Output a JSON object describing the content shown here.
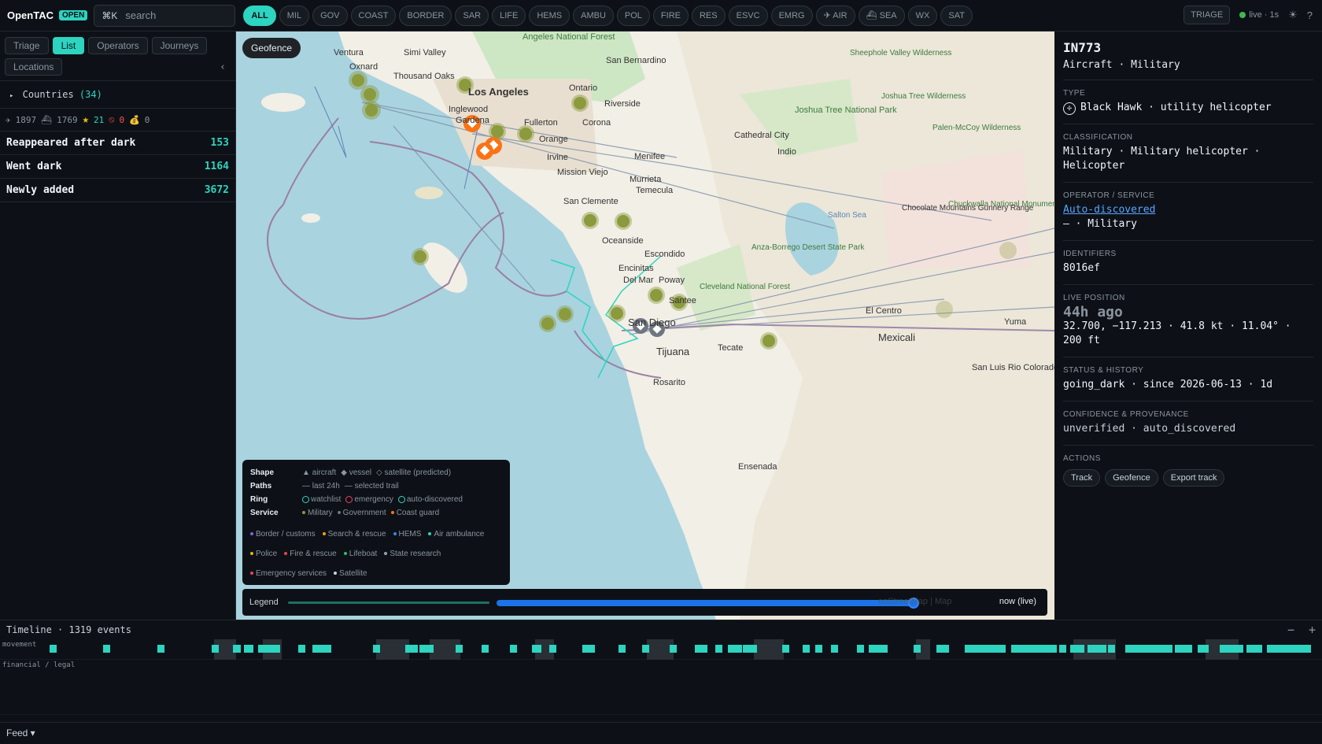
{
  "app": {
    "name": "OpenTAC",
    "badge": "OPEN"
  },
  "search": {
    "shortcut": "⌘K",
    "placeholder": "search"
  },
  "filters": [
    "ALL",
    "MIL",
    "GOV",
    "COAST",
    "BORDER",
    "SAR",
    "LIFE",
    "HEMS",
    "AMBU",
    "POL",
    "FIRE",
    "RES",
    "ESVC",
    "EMRG",
    "✈ AIR",
    "⛴ SEA",
    "WX",
    "SAT"
  ],
  "active_filter": "ALL",
  "topright": {
    "triage": "TRIAGE",
    "live": "live · 1s",
    "theme_icon": "☀",
    "help": "?"
  },
  "sidebar": {
    "tabs": [
      "Triage",
      "List",
      "Operators",
      "Journeys",
      "Locations"
    ],
    "active_tab": "List",
    "collapse": "‹",
    "countries_label": "Countries",
    "countries_count": "(34)",
    "stats": {
      "air": "1897",
      "sea": "1769",
      "star": "21",
      "blocked": "0",
      "money": "0"
    },
    "rows": [
      {
        "label": "Reappeared after dark",
        "count": "153"
      },
      {
        "label": "Went dark",
        "count": "1164"
      },
      {
        "label": "Newly added",
        "count": "3672"
      }
    ]
  },
  "map": {
    "geofence": "Geofence",
    "place_labels": [
      "Ventura",
      "Oxnard",
      "Simi Valley",
      "Thousand Oaks",
      "Angeles National Forest",
      "Los Angeles",
      "Ontario",
      "San Bernardino",
      "Inglewood",
      "Gardena",
      "Fullerton",
      "Corona",
      "Riverside",
      "Orange",
      "Irvine",
      "Mission Viejo",
      "Menifee",
      "Murrieta",
      "Temecula",
      "San Clemente",
      "Oceanside",
      "Escondido",
      "Encinitas",
      "Del Mar",
      "Poway",
      "San Diego",
      "Tijuana",
      "Rosarito",
      "Tecate",
      "Ensenada",
      "Mexicali",
      "El Centro",
      "Yuma",
      "San Luis Rio Colorado",
      "Joshua Tree National Park",
      "Cathedral City",
      "Indio",
      "Salton Sea",
      "Chocolate Mountains Gunnery Range",
      "Chuckwalla National Monument",
      "Anza-Borrego Desert State Park",
      "Cleveland National Forest",
      "Sheephole Valley Wilderness",
      "Joshua Tree Wilderness",
      "Palen-McCoy Wilderness",
      "Santee"
    ],
    "legend": {
      "shape_label": "Shape",
      "shape": [
        "▲ aircraft",
        "◆ vessel",
        "◇ satellite (predicted)"
      ],
      "paths_label": "Paths",
      "paths": [
        "— last 24h",
        "— selected trail"
      ],
      "ring_label": "Ring",
      "ring": [
        "watchlist",
        "emergency",
        "auto-discovered"
      ],
      "service_label": "Service",
      "services": [
        {
          "name": "Military",
          "color": "#8b9a3c"
        },
        {
          "name": "Government",
          "color": "#6e7681"
        },
        {
          "name": "Coast guard",
          "color": "#f97316"
        },
        {
          "name": "Border / customs",
          "color": "#8b5cf6"
        },
        {
          "name": "Search & rescue",
          "color": "#f59e0b"
        },
        {
          "name": "HEMS",
          "color": "#3b82f6"
        },
        {
          "name": "Air ambulance",
          "color": "#2dd4bf"
        },
        {
          "name": "Police",
          "color": "#eab308"
        },
        {
          "name": "Fire & rescue",
          "color": "#ef4444"
        },
        {
          "name": "Lifeboat",
          "color": "#22c55e"
        },
        {
          "name": "State research",
          "color": "#94a3b8"
        },
        {
          "name": "Emergency services",
          "color": "#f43f5e"
        },
        {
          "name": "Satellite",
          "color": "#cbd5e1"
        }
      ]
    },
    "timebar": {
      "label": "Legend",
      "now": "now (live)",
      "attribution": "enStreetMap | Map"
    }
  },
  "detail": {
    "callsign": "IN773",
    "subtitle": "Aircraft · Military",
    "type_h": "TYPE",
    "type_v": "Black Hawk · utility helicopter",
    "class_h": "CLASSIFICATION",
    "class_v": "Military · Military helicopter · Helicopter",
    "op_h": "OPERATOR / SERVICE",
    "op_link": "Auto-discovered",
    "op_v": "— · Military",
    "id_h": "IDENTIFIERS",
    "id_v": "8016ef",
    "pos_h": "LIVE POSITION",
    "pos_age": "44h ago",
    "pos_v": "32.700, −117.213 · 41.8 kt · 11.04° · 200 ft",
    "status_h": "STATUS & HISTORY",
    "status_v": "going_dark · since 2026-06-13 · 1d",
    "conf_h": "CONFIDENCE & PROVENANCE",
    "conf_v": "unverified · auto_discovered",
    "actions_h": "ACTIONS",
    "actions": [
      "Track",
      "Geofence",
      "Export track"
    ]
  },
  "timeline": {
    "title": "Timeline · 1319 events",
    "minus": "−",
    "plus": "+",
    "lanes": [
      "movement",
      "financial / legal"
    ]
  },
  "feed": {
    "label": "Feed ▾"
  },
  "colors": {
    "accent": "#2dd4bf",
    "bg": "#0d1117",
    "panel_border": "#21262d",
    "link": "#58a6ff",
    "live": "#3fb950"
  }
}
